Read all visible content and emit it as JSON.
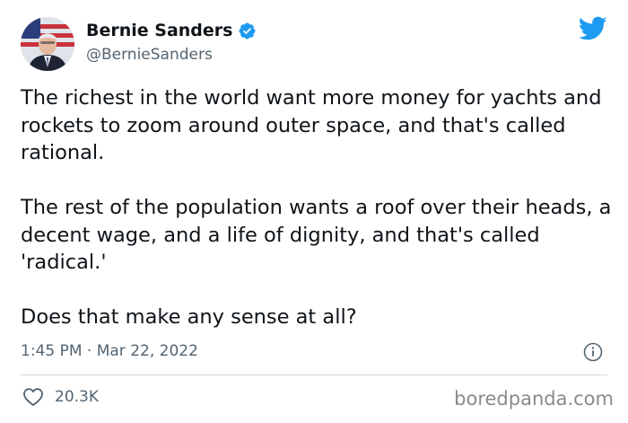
{
  "author": {
    "display_name": "Bernie Sanders",
    "handle": "@BernieSanders",
    "verified": true,
    "avatar_icon": "profile-photo",
    "verified_icon": "verified-badge-icon"
  },
  "brand": {
    "icon": "twitter-bird-icon",
    "color": "#1d9bf0"
  },
  "tweet": {
    "paragraphs": [
      "The richest in the world want more money for yachts and rockets to zoom around outer space, and that's called rational.",
      "The rest of the population wants a roof over their heads, a decent wage, and a life of dignity, and that's called 'radical.'",
      "Does that make any sense at all?"
    ],
    "timestamp": "1:45 PM · Mar 22, 2022"
  },
  "footer": {
    "like_icon": "heart-icon",
    "like_count": "20.3K",
    "info_icon": "info-icon",
    "watermark": "boredpanda.com"
  },
  "colors": {
    "text": "#0f1419",
    "secondary": "#536471",
    "divider": "#cfd9de",
    "watermark": "#8a8a8a"
  }
}
